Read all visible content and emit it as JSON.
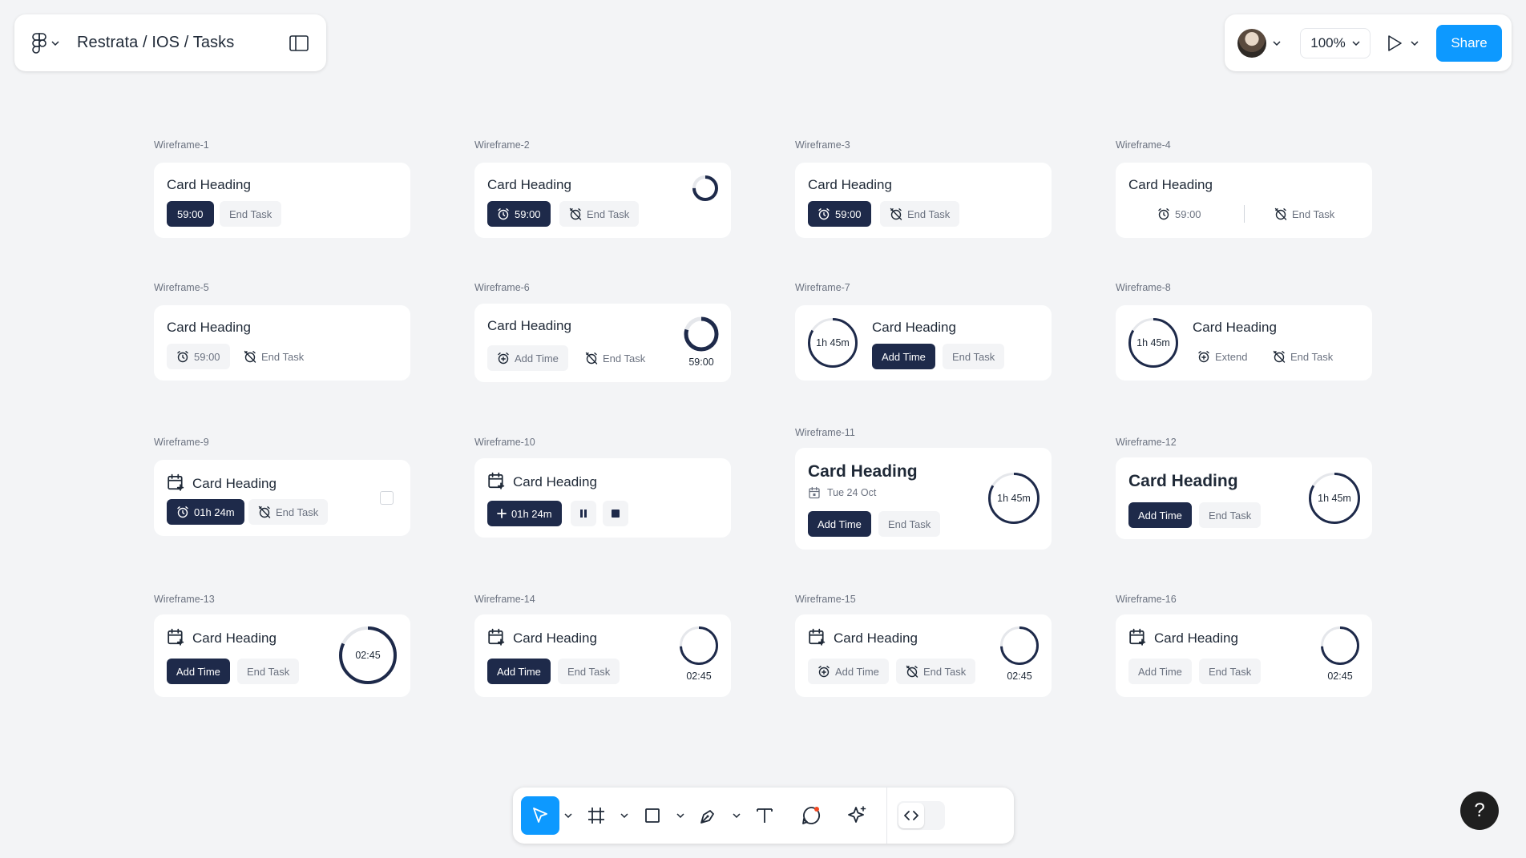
{
  "header": {
    "breadcrumb": "Restrata / IOS / Tasks"
  },
  "topbar": {
    "zoom": "100%",
    "share_label": "Share"
  },
  "colors": {
    "accent": "#0d99ff",
    "primary_dark": "#1e2a4a",
    "canvas": "#f3f4f6"
  },
  "wireframes": [
    {
      "label": "Wireframe-1",
      "heading": "Card Heading",
      "timer_button": "59:00",
      "end_button": "End Task"
    },
    {
      "label": "Wireframe-2",
      "heading": "Card Heading",
      "timer_button": "59:00",
      "end_button": "End Task"
    },
    {
      "label": "Wireframe-3",
      "heading": "Card Heading",
      "timer_button": "59:00",
      "end_button": "End Task"
    },
    {
      "label": "Wireframe-4",
      "heading": "Card Heading",
      "timer_button": "59:00",
      "end_button": "End Task"
    },
    {
      "label": "Wireframe-5",
      "heading": "Card Heading",
      "timer_button": "59:00",
      "end_button": "End Task"
    },
    {
      "label": "Wireframe-6",
      "heading": "Card Heading",
      "add_button": "Add Time",
      "end_button": "End Task",
      "time": "59:00"
    },
    {
      "label": "Wireframe-7",
      "heading": "Card Heading",
      "ring_text": "1h 45m",
      "add_button": "Add Time",
      "end_button": "End Task"
    },
    {
      "label": "Wireframe-8",
      "heading": "Card Heading",
      "ring_text": "1h 45m",
      "extend_button": "Extend",
      "end_button": "End Task"
    },
    {
      "label": "Wireframe-9",
      "heading": "Card Heading",
      "timer_button": "01h 24m",
      "end_button": "End Task"
    },
    {
      "label": "Wireframe-10",
      "heading": "Card Heading",
      "timer_button": "01h 24m"
    },
    {
      "label": "Wireframe-11",
      "heading": "Card Heading",
      "date": "Tue 24 Oct",
      "ring_text": "1h 45m",
      "add_button": "Add Time",
      "end_button": "End Task"
    },
    {
      "label": "Wireframe-12",
      "heading": "Card Heading",
      "ring_text": "1h 45m",
      "add_button": "Add Time",
      "end_button": "End Task"
    },
    {
      "label": "Wireframe-13",
      "heading": "Card Heading",
      "ring_text": "02:45",
      "add_button": "Add Time",
      "end_button": "End Task"
    },
    {
      "label": "Wireframe-14",
      "heading": "Card Heading",
      "time": "02:45",
      "add_button": "Add Time",
      "end_button": "End Task"
    },
    {
      "label": "Wireframe-15",
      "heading": "Card Heading",
      "time": "02:45",
      "add_button": "Add Time",
      "end_button": "End Task"
    },
    {
      "label": "Wireframe-16",
      "heading": "Card Heading",
      "time": "02:45",
      "add_button": "Add Time",
      "end_button": "End Task"
    }
  ],
  "toolbar": {
    "tools": [
      "move-tool",
      "frame-tool",
      "shape-tool",
      "pen-tool",
      "text-tool",
      "comment-tool",
      "actions-tool"
    ],
    "dev_mode_icon": "code-icon"
  },
  "help_label": "?"
}
